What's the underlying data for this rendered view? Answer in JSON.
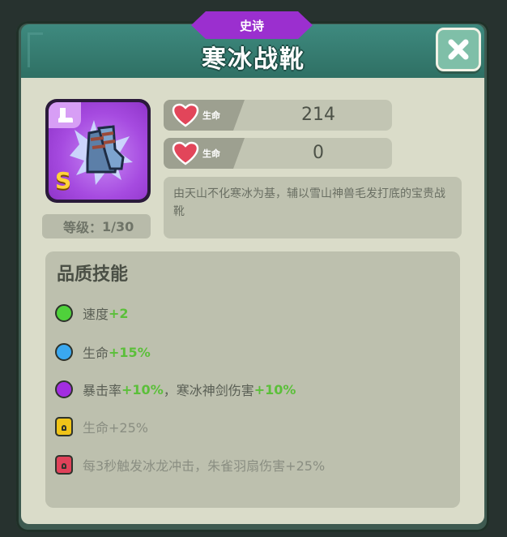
{
  "header": {
    "rarity": "史诗",
    "title": "寒冰战靴",
    "close_icon": "close-x-icon"
  },
  "item": {
    "grade": "S",
    "level_label": "等级：",
    "level_value": "1/30"
  },
  "stats": [
    {
      "icon": "heart-icon",
      "label": "生命",
      "value": "214"
    },
    {
      "icon": "heart-icon",
      "label": "生命",
      "value": "0"
    }
  ],
  "description": "由天山不化寒冰为基，辅以雪山神兽毛发打底的宝贵战靴",
  "skills": {
    "title": "品质技能",
    "items": [
      {
        "color": "#4fd13b",
        "parts": [
          {
            "text": "速度",
            "bonus": false
          },
          {
            "text": "+2",
            "bonus": true
          }
        ],
        "locked": false
      },
      {
        "color": "#3aa8f0",
        "parts": [
          {
            "text": "生命",
            "bonus": false
          },
          {
            "text": "+15%",
            "bonus": true
          }
        ],
        "locked": false
      },
      {
        "color": "#a22de0",
        "parts": [
          {
            "text": "暴击率",
            "bonus": false
          },
          {
            "text": "+10%",
            "bonus": true
          },
          {
            "text": "，寒冰神剑伤害",
            "bonus": false
          },
          {
            "text": "+10%",
            "bonus": true
          }
        ],
        "locked": false
      },
      {
        "color": "#f0c419",
        "parts": [
          {
            "text": "生命+25%",
            "bonus": false
          }
        ],
        "locked": true
      },
      {
        "color": "#e0425a",
        "parts": [
          {
            "text": "每3秒触发冰龙冲击，朱雀羽扇伤害+25%",
            "bonus": false
          }
        ],
        "locked": true
      }
    ]
  }
}
